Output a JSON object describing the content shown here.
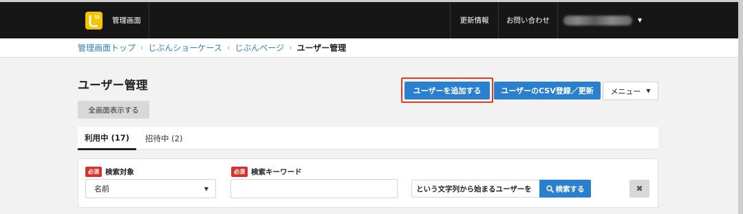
{
  "header": {
    "app_title": "管理画面",
    "nav_updates": "更新情報",
    "nav_contact": "お問い合わせ"
  },
  "breadcrumb": {
    "items": [
      "管理画面トップ",
      "じぶんショーケース",
      "じぶんページ"
    ],
    "current": "ユーザー管理"
  },
  "page": {
    "title": "ユーザー管理",
    "add_user_label": "ユーザーを追加する",
    "csv_label": "ユーザーのCSV登録／更新",
    "menu_label": "メニュー",
    "fullscreen_label": "全画面表示する"
  },
  "tabs": [
    {
      "label": "利用中 (17)",
      "active": true
    },
    {
      "label": "招待中 (2)",
      "active": false
    }
  ],
  "search": {
    "required_badge": "必須",
    "target_label": "検索対象",
    "target_value": "名前",
    "keyword_label": "検索キーワード",
    "keyword_value": "",
    "match_value": "という文字列から始まるユーザーを",
    "search_button": "検索する",
    "clear_button": "✖"
  },
  "colors": {
    "accent": "#2a80cf",
    "header_bg": "#161616",
    "logo": "#f5c400",
    "required": "#d9302c",
    "highlight": "#e53a1e"
  }
}
